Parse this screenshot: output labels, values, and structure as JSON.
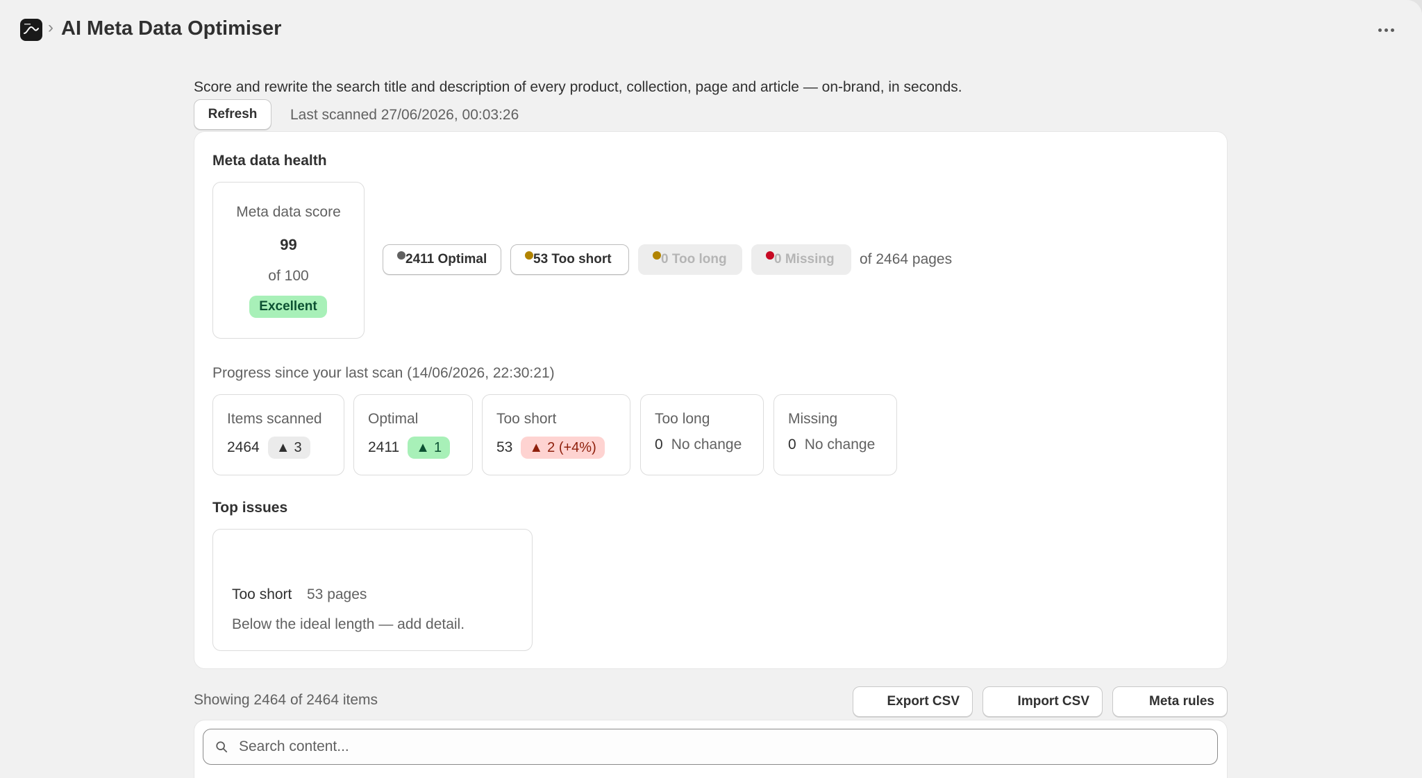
{
  "app": {
    "title": "AI Meta Data Optimiser",
    "breadcrumb_separator": "›"
  },
  "intro": "Score and rewrite the search title and description of every product, collection, page and article — on-brand, in seconds.",
  "refresh_label": "Refresh",
  "last_scanned": "Last scanned 27/06/2026, 00:03:26",
  "health": {
    "title": "Meta data health",
    "score_label": "Meta data score",
    "score_value": "99",
    "score_of": "of 100",
    "score_badge": "Excellent",
    "filters": [
      {
        "label": "2411 Optimal",
        "dot_color": "#616161",
        "state": "active"
      },
      {
        "label": "53 Too short",
        "dot_color": "#b28400",
        "state": "active"
      },
      {
        "label": "0 Too long",
        "dot_color": "#b28400",
        "state": "disabled"
      },
      {
        "label": "0 Missing",
        "dot_color": "#c70a24",
        "state": "disabled"
      }
    ],
    "pages_total": "of 2464 pages"
  },
  "progress": {
    "title": "Progress since your last scan (14/06/2026, 22:30:21)",
    "stats": [
      {
        "label": "Items scanned",
        "value": "2464",
        "delta": "3",
        "delta_kind": "neutral"
      },
      {
        "label": "Optimal",
        "value": "2411",
        "delta": "1",
        "delta_kind": "good"
      },
      {
        "label": "Too short",
        "value": "53",
        "delta": "2 (+4%)",
        "delta_kind": "bad"
      },
      {
        "label": "Too long",
        "value": "0",
        "delta": "No change",
        "delta_kind": "none"
      },
      {
        "label": "Missing",
        "value": "0",
        "delta": "No change",
        "delta_kind": "none"
      }
    ]
  },
  "top_issues": {
    "title": "Top issues",
    "items": [
      {
        "name": "Too short",
        "count": "53 pages",
        "description": "Below the ideal length — add detail."
      }
    ]
  },
  "list": {
    "showing": "Showing 2464 of 2464 items",
    "export_label": "Export CSV",
    "import_label": "Import CSV",
    "rules_label": "Meta rules",
    "search_placeholder": "Search content..."
  },
  "icons": {
    "app_logo": "app-logo-icon",
    "more": "more-horizontal-icon",
    "delta_up": "triangle-up-icon",
    "search": "search-icon"
  }
}
